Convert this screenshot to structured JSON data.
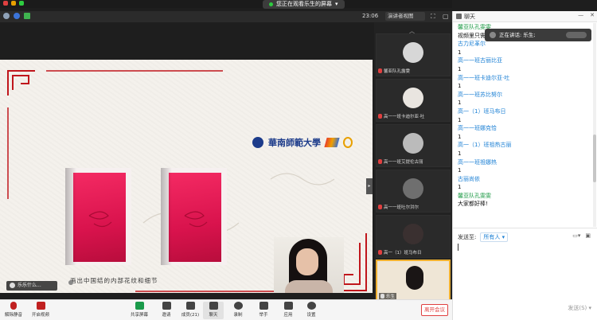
{
  "top": {
    "recording_banner": "您正在观看乐生的屏幕",
    "view_button": "演讲者视图",
    "time": "23:06"
  },
  "slide": {
    "school_name": "華南師範大學",
    "caption": "画出中国结的内部花纹和细节",
    "speaker_name_tag": "乐乐什么..."
  },
  "gallery": {
    "tiles": [
      {
        "name": "馨亚队孔露雯"
      },
      {
        "name": "高一一班卡迪尔亚·吐"
      },
      {
        "name": "高一一班艾提伦古丽"
      },
      {
        "name": "高一一班吐尔洪尔"
      },
      {
        "name": "高一（1）班马布日"
      },
      {
        "name": "乐生"
      }
    ]
  },
  "toolbar": {
    "items": [
      {
        "label": "解除静音",
        "icon": "mic-muted-icon"
      },
      {
        "label": "开启视频",
        "icon": "video-off-icon"
      },
      {
        "label": "共享屏幕",
        "icon": "share-screen-icon"
      },
      {
        "label": "邀请",
        "icon": "invite-icon"
      },
      {
        "label": "成员(21)",
        "icon": "members-icon"
      },
      {
        "label": "聊天",
        "icon": "chat-icon"
      },
      {
        "label": "录制",
        "icon": "record-icon"
      },
      {
        "label": "举手",
        "icon": "raise-hand-icon"
      },
      {
        "label": "应用",
        "icon": "apps-icon"
      },
      {
        "label": "设置",
        "icon": "settings-icon"
      }
    ],
    "leave_label": "离开会议"
  },
  "chat": {
    "title": "聊天",
    "toast": "正在讲话: 乐生;",
    "messages": [
      {
        "kind": "host",
        "text": "馨亚队孔雯雯"
      },
      {
        "kind": "body",
        "text": "视频里只需要截一张..."
      },
      {
        "kind": "name",
        "text": "古力尼革尔"
      },
      {
        "kind": "body",
        "text": "1"
      },
      {
        "kind": "name",
        "text": "高一一班古丽比亚"
      },
      {
        "kind": "body",
        "text": "1"
      },
      {
        "kind": "name",
        "text": "高一一班卡迪尔亚·吐"
      },
      {
        "kind": "body",
        "text": "1"
      },
      {
        "kind": "name",
        "text": "高一一班苏比努尔"
      },
      {
        "kind": "body",
        "text": "1"
      },
      {
        "kind": "name",
        "text": "高一（1）班马布日"
      },
      {
        "kind": "body",
        "text": "1"
      },
      {
        "kind": "name",
        "text": "高一一班娜克恰"
      },
      {
        "kind": "body",
        "text": "1"
      },
      {
        "kind": "name",
        "text": "高一（1）班祖热古丽"
      },
      {
        "kind": "body",
        "text": "1"
      },
      {
        "kind": "name",
        "text": "高一一班祖娜热"
      },
      {
        "kind": "body",
        "text": "1"
      },
      {
        "kind": "name",
        "text": "古丽尚依"
      },
      {
        "kind": "body",
        "text": "1"
      },
      {
        "kind": "host",
        "text": "馨亚队孔雯雯"
      },
      {
        "kind": "body",
        "text": "大家都好棒!"
      }
    ],
    "send_to_label": "发送至:",
    "recipient": "所有人",
    "send_button": "发送(S)"
  }
}
